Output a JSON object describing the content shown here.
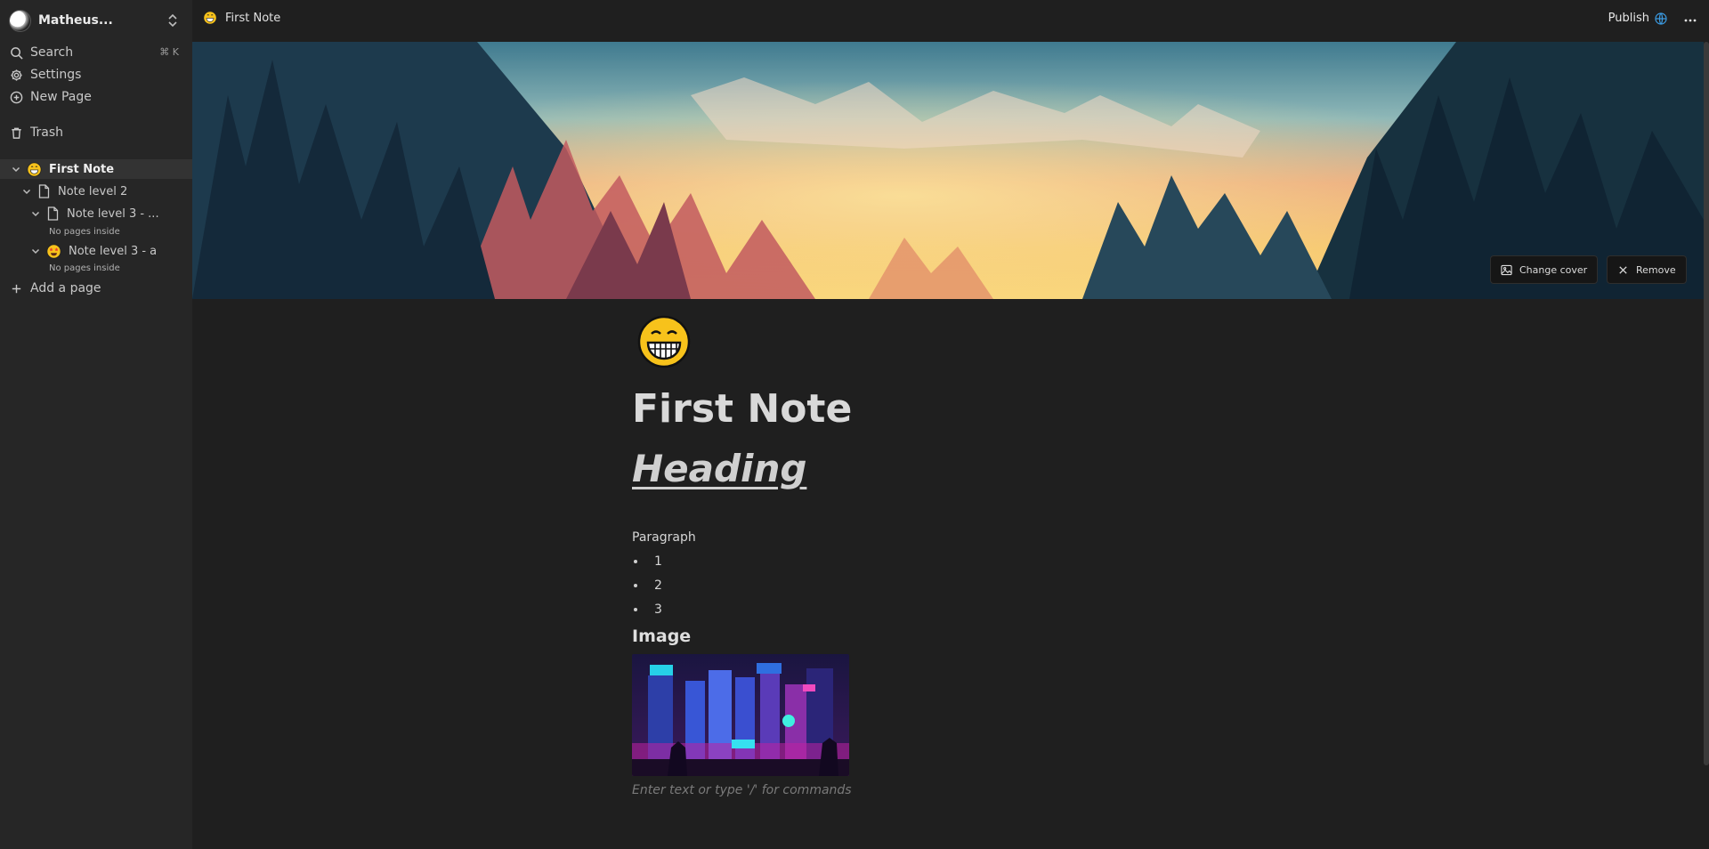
{
  "sidebar": {
    "user_name": "Matheus...",
    "nav": [
      {
        "label": "Search",
        "shortcut": "⌘ K",
        "icon": "search-icon"
      },
      {
        "label": "Settings",
        "icon": "gear-icon"
      },
      {
        "label": "New Page",
        "icon": "plus-circle-icon"
      },
      {
        "label": "Trash",
        "icon": "trash-icon"
      }
    ],
    "tree": [
      {
        "label": "First Note",
        "level": 1,
        "icon": "grinning-face-emoji",
        "active": true
      },
      {
        "label": "Note level 2",
        "level": 2,
        "icon": "page-icon"
      },
      {
        "label": "Note level 3 - ...",
        "level": 3,
        "icon": "page-icon",
        "note": "No pages inside"
      },
      {
        "label": "Note level 3 - a",
        "level": 3,
        "icon": "star-struck-emoji",
        "note": "No pages inside"
      }
    ],
    "add_page": "Add a page"
  },
  "topbar": {
    "breadcrumb_title": "First Note",
    "publish_label": "Publish",
    "icons": [
      "globe-icon",
      "more-horizontal-icon"
    ]
  },
  "cover": {
    "change_cover_label": "Change cover",
    "remove_label": "Remove"
  },
  "editor": {
    "title": "First Note",
    "heading": "Heading",
    "paragraph": "Paragraph",
    "bullets": [
      "1",
      "2",
      "3"
    ],
    "image_heading": "Image",
    "placeholder": "Enter text or type '/' for commands"
  },
  "colors": {
    "background": "#1f1f1f",
    "sidebar": "#262626",
    "active_row": "#333333",
    "publish_globe": "#3b9ae1"
  }
}
